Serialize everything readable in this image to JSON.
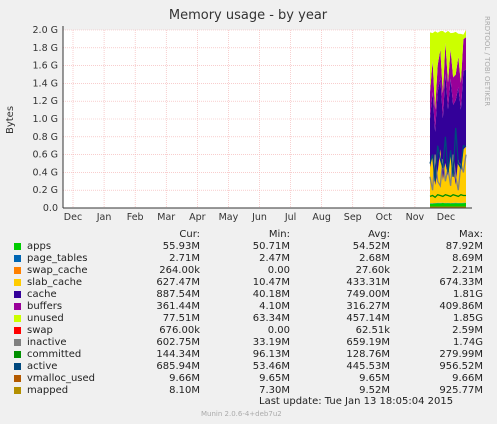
{
  "chart_data": {
    "type": "area",
    "title": "Memory usage - by year",
    "ylabel": "Bytes",
    "side_label": "RRDTOOL / TOBI OETIKER",
    "x_ticks": [
      "Dec",
      "Jan",
      "Feb",
      "Mar",
      "Apr",
      "May",
      "Jun",
      "Jul",
      "Aug",
      "Sep",
      "Oct",
      "Nov",
      "Dec"
    ],
    "y_ticks": [
      "0.0",
      "0.2 G",
      "0.4 G",
      "0.6 G",
      "0.8 G",
      "1.0 G",
      "1.2 G",
      "1.4 G",
      "1.6 G",
      "1.8 G",
      "2.0 G"
    ],
    "ylim": [
      0,
      2.0
    ],
    "y_unit": "G",
    "grid": true,
    "stack_order": [
      "apps",
      "page_tables",
      "swap_cache",
      "slab_cache",
      "cache",
      "buffers",
      "unused",
      "swap"
    ],
    "stack_values_gb": {
      "apps": [
        0.05,
        0.05,
        0.052,
        0.055,
        0.054,
        0.056,
        0.053,
        0.055,
        0.052,
        0.054,
        0.055,
        0.054,
        0.053,
        0.055,
        0.056
      ],
      "page_tables": [
        0.003,
        0.003,
        0.003,
        0.003,
        0.003,
        0.003,
        0.003,
        0.003,
        0.003,
        0.003,
        0.003,
        0.003,
        0.003,
        0.003,
        0.003
      ],
      "swap_cache": [
        0.0,
        0.002,
        0.0,
        0.0,
        0.001,
        0.0,
        0.0,
        0.002,
        0.0,
        0.0,
        0.001,
        0.0,
        0.0,
        0.0,
        0.0
      ],
      "slab_cache": [
        0.4,
        0.55,
        0.2,
        0.35,
        0.6,
        0.25,
        0.45,
        0.3,
        0.55,
        0.4,
        0.2,
        0.5,
        0.35,
        0.6,
        0.63
      ],
      "cache": [
        0.55,
        0.7,
        0.6,
        0.9,
        0.8,
        0.7,
        1.0,
        0.75,
        0.85,
        0.7,
        0.95,
        0.8,
        0.7,
        0.88,
        0.87
      ],
      "buffers": [
        0.3,
        0.35,
        0.25,
        0.3,
        0.32,
        0.28,
        0.35,
        0.3,
        0.33,
        0.31,
        0.29,
        0.34,
        0.3,
        0.36,
        0.36
      ],
      "unused": [
        0.67,
        0.31,
        0.88,
        0.36,
        0.21,
        0.7,
        0.11,
        0.58,
        0.18,
        0.5,
        0.48,
        0.26,
        0.55,
        0.05,
        0.08
      ],
      "swap": [
        0.0,
        0.0,
        0.0,
        0.0,
        0.0,
        0.0,
        0.0,
        0.0,
        0.0,
        0.0,
        0.0,
        0.0,
        0.0,
        0.0,
        0.001
      ]
    },
    "line_values_gb": {
      "inactive": [
        0.35,
        0.2,
        0.6,
        0.3,
        0.25,
        0.55,
        0.3,
        0.45,
        0.25,
        0.6,
        0.35,
        0.2,
        0.5,
        0.4,
        0.6
      ],
      "committed": [
        0.13,
        0.14,
        0.12,
        0.15,
        0.14,
        0.13,
        0.15,
        0.14,
        0.13,
        0.15,
        0.14,
        0.13,
        0.15,
        0.14,
        0.14
      ],
      "active": [
        0.5,
        0.6,
        0.3,
        0.7,
        0.55,
        0.45,
        0.8,
        0.4,
        0.65,
        0.35,
        0.9,
        0.5,
        0.45,
        0.7,
        0.69
      ],
      "vmalloc_used": [
        0.01,
        0.01,
        0.01,
        0.01,
        0.01,
        0.01,
        0.01,
        0.01,
        0.01,
        0.01,
        0.01,
        0.01,
        0.01,
        0.01,
        0.01
      ],
      "mapped": [
        0.008,
        0.008,
        0.008,
        0.008,
        0.008,
        0.008,
        0.008,
        0.008,
        0.008,
        0.008,
        0.008,
        0.008,
        0.008,
        0.008,
        0.008
      ]
    }
  },
  "legend": {
    "headers": {
      "cur": "Cur:",
      "min": "Min:",
      "avg": "Avg:",
      "max": "Max:"
    },
    "rows": [
      {
        "name": "apps",
        "color": "#00cc00",
        "cur": "55.93M",
        "min": "50.71M",
        "avg": "54.52M",
        "max": "87.92M"
      },
      {
        "name": "page_tables",
        "color": "#0066b3",
        "cur": "2.71M",
        "min": "2.47M",
        "avg": "2.68M",
        "max": "8.69M"
      },
      {
        "name": "swap_cache",
        "color": "#ff8000",
        "cur": "264.00k",
        "min": "0.00",
        "avg": "27.60k",
        "max": "2.21M"
      },
      {
        "name": "slab_cache",
        "color": "#ffcc00",
        "cur": "627.47M",
        "min": "10.47M",
        "avg": "433.31M",
        "max": "674.33M"
      },
      {
        "name": "cache",
        "color": "#330099",
        "cur": "887.54M",
        "min": "40.18M",
        "avg": "749.00M",
        "max": "1.81G"
      },
      {
        "name": "buffers",
        "color": "#990099",
        "cur": "361.44M",
        "min": "4.10M",
        "avg": "316.27M",
        "max": "409.86M"
      },
      {
        "name": "unused",
        "color": "#ccff00",
        "cur": "77.51M",
        "min": "63.34M",
        "avg": "457.14M",
        "max": "1.85G"
      },
      {
        "name": "swap",
        "color": "#ff0000",
        "cur": "676.00k",
        "min": "0.00",
        "avg": "62.51k",
        "max": "2.59M"
      },
      {
        "name": "inactive",
        "color": "#808080",
        "cur": "602.75M",
        "min": "33.19M",
        "avg": "659.19M",
        "max": "1.74G"
      },
      {
        "name": "committed",
        "color": "#008f00",
        "cur": "144.34M",
        "min": "96.13M",
        "avg": "128.76M",
        "max": "279.99M"
      },
      {
        "name": "active",
        "color": "#00487d",
        "cur": "685.94M",
        "min": "53.46M",
        "avg": "445.53M",
        "max": "956.52M"
      },
      {
        "name": "vmalloc_used",
        "color": "#b35a00",
        "cur": "9.66M",
        "min": "9.65M",
        "avg": "9.65M",
        "max": "9.66M"
      },
      {
        "name": "mapped",
        "color": "#b38f00",
        "cur": "8.10M",
        "min": "7.30M",
        "avg": "9.52M",
        "max": "925.77M"
      }
    ]
  },
  "last_update": "Last update:  Tue Jan 13 18:05:04 2015",
  "version": "Munin 2.0.6-4+deb7u2"
}
